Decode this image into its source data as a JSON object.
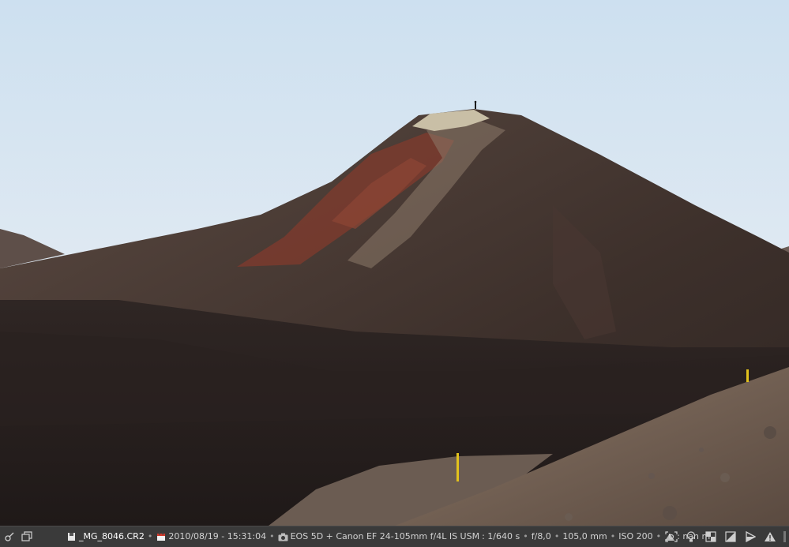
{
  "statusbar": {
    "filename": "_MG_8046.CR2",
    "datetime": "2010/08/19 - 15:31:04",
    "camera": "EOS 5D + Canon EF 24-105mm f/4L IS USM",
    "shutter": ": 1/640 s",
    "aperture": "f/8,0",
    "focal_length": "105,0 mm",
    "iso": "ISO 200",
    "altitude": ": nan m",
    "separator": "•"
  },
  "icons": {
    "left": [
      "navigator-icon",
      "multi-window-icon"
    ],
    "meta": [
      "file-icon",
      "calendar-icon",
      "camera-icon",
      "mountain-icon"
    ],
    "right": [
      "focus-mask-icon",
      "bulb-icon",
      "before-after-icon",
      "exposure-icon",
      "softproof-icon",
      "warning-icon",
      "scroll-indicator"
    ]
  },
  "colors": {
    "statusbar_bg": "#3a3a3a",
    "text": "#d2d2d2",
    "filename": "#ffffff",
    "sky_top": "#cde0f0",
    "sky_bottom": "#eef1f3"
  }
}
